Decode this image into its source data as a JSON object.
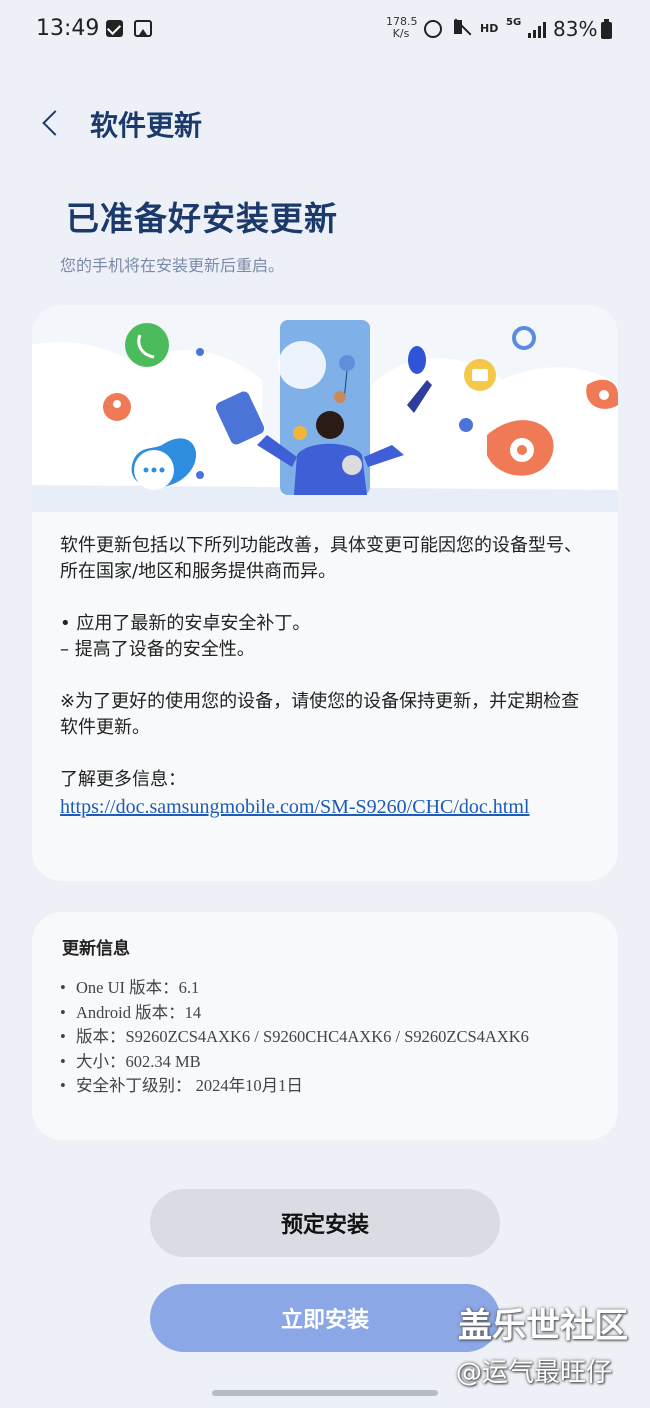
{
  "status_bar": {
    "time": "13:49",
    "net_speed_value": "178.5",
    "net_speed_unit": "K/s",
    "hd_label": "HD",
    "network_label": "5G",
    "battery_percent": "83%"
  },
  "header": {
    "title": "软件更新"
  },
  "main": {
    "headline": "已准备好安装更新",
    "subtitle": "您的手机将在安装更新后重启。",
    "release_notes": {
      "intro": "软件更新包括以下所列功能改善，具体变更可能因您的设备型号、所在国家/地区和服务提供商而异。",
      "bullets": "• 应用了最新的安卓安全补丁。\n – 提高了设备的安全性。",
      "advice": "※为了更好的使用您的设备，请使您的设备保持更新，并定期检查软件更新。",
      "more_info_label": "了解更多信息：",
      "more_info_link": "https://doc.samsungmobile.com/SM-S9260/CHC/doc.html"
    }
  },
  "update_info": {
    "title": "更新信息",
    "items": [
      "One UI 版本：6.1",
      "Android 版本：14",
      "版本：S9260ZCS4AXK6 / S9260CHC4AXK6 / S9260ZCS4AXK6",
      "大小：602.34 MB",
      "安全补丁级别： 2024年10月1日"
    ]
  },
  "actions": {
    "schedule_label": "预定安装",
    "install_label": "立即安装"
  },
  "watermark": {
    "line1": "盖乐世社区",
    "line2": "@运气最旺仔"
  },
  "colors": {
    "accent": "#1b3a6b",
    "install_button": "#8ba7e6",
    "schedule_button": "#d9dce2",
    "link": "#1c5bb8",
    "background": "#edf1f7"
  },
  "icons": [
    "back-chevron-icon",
    "checkbox-icon",
    "image-icon",
    "alarm-icon",
    "mute-icon",
    "signal-icon",
    "battery-icon"
  ]
}
